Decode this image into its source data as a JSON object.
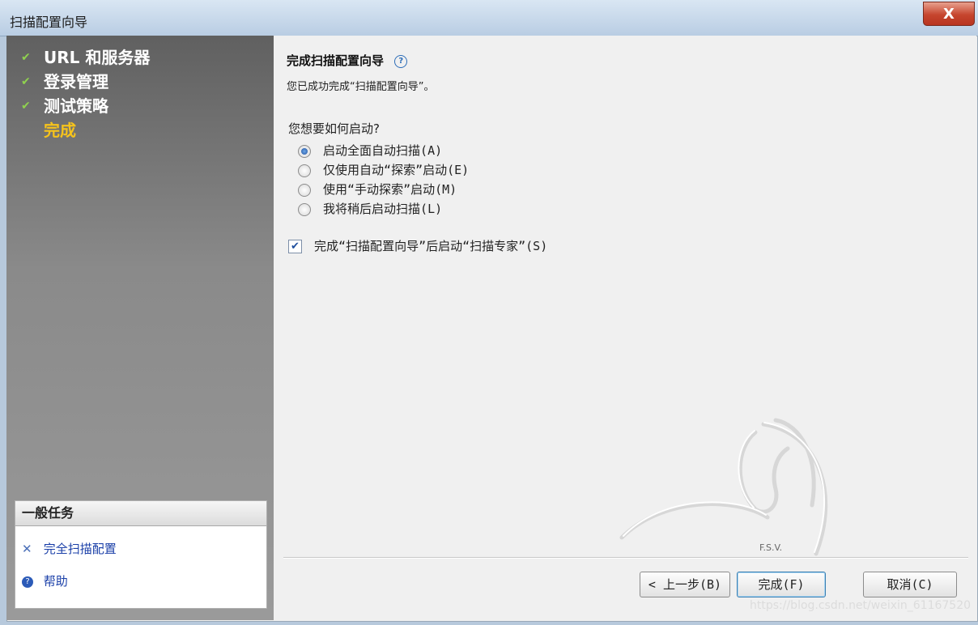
{
  "window": {
    "title": "扫描配置向导",
    "close_label": "X"
  },
  "steps": [
    {
      "label": "URL 和服务器",
      "completed": true
    },
    {
      "label": "登录管理",
      "completed": true
    },
    {
      "label": "测试策略",
      "completed": true
    },
    {
      "label": "完成",
      "completed": false,
      "current": true
    }
  ],
  "tasks": {
    "header": "一般任务",
    "items": [
      {
        "label": "完全扫描配置",
        "icon": "tools-icon"
      },
      {
        "label": "帮助",
        "icon": "help-icon"
      }
    ]
  },
  "main": {
    "heading": "完成扫描配置向导",
    "heading_help_icon": "?",
    "subtext": "您已成功完成“扫描配置向导”。",
    "question": "您想要如何启动?",
    "radios": [
      {
        "label": "启动全面自动扫描(A)",
        "selected": true
      },
      {
        "label": "仅使用自动“探索”启动(E)",
        "selected": false
      },
      {
        "label": "使用“手动探索”启动(M)",
        "selected": false
      },
      {
        "label": "我将稍后启动扫描(L)",
        "selected": false
      }
    ],
    "checkbox": {
      "label": "完成“扫描配置向导”后启动“扫描专家”(S)",
      "checked": true
    }
  },
  "buttons": {
    "back": "< 上一步(B)",
    "finish": "完成(F)",
    "cancel": "取消(C)"
  },
  "watermark": {
    "logo_text": "F.S.V.",
    "url": "https://blog.csdn.net/weixin_61167520"
  },
  "colors": {
    "current_step": "#f6c31c",
    "check": "#8fd14f",
    "link": "#1a3fa8"
  }
}
